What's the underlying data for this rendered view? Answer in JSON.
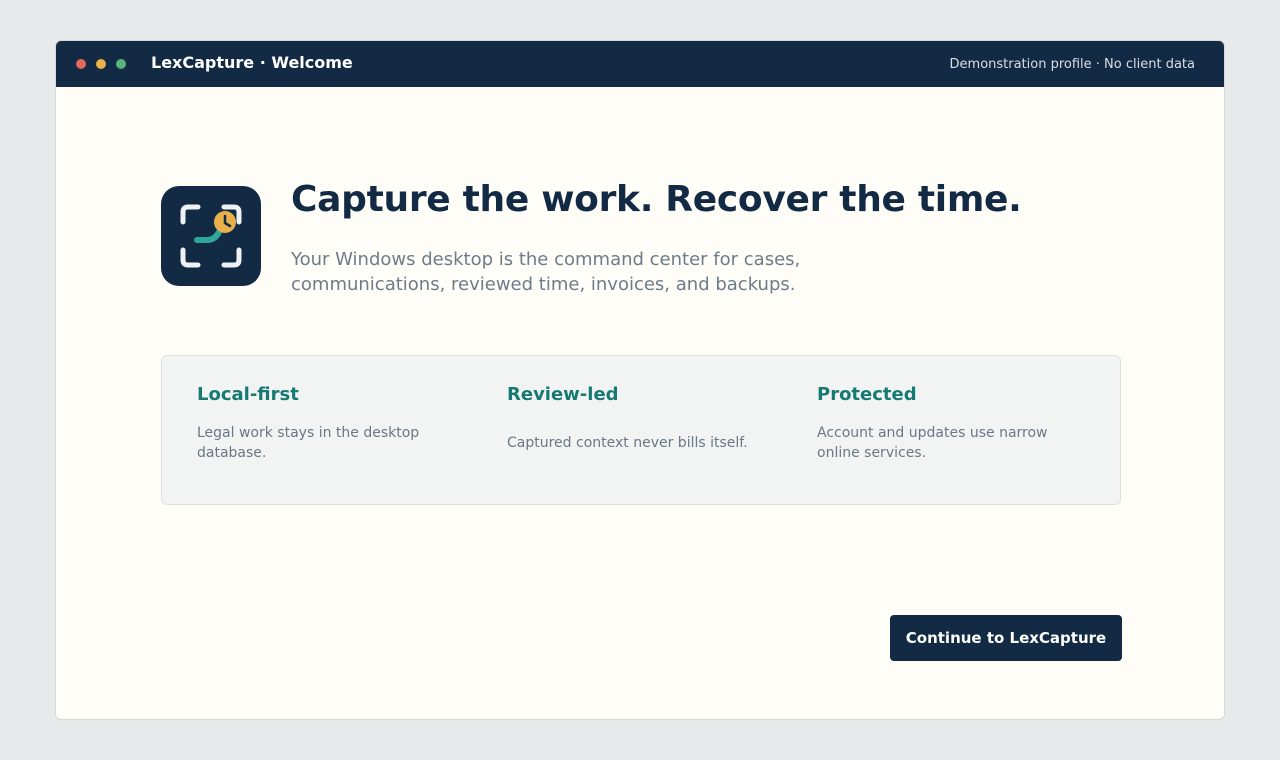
{
  "window": {
    "title": "LexCapture · Welcome",
    "profile_note": "Demonstration profile · No client data",
    "controls": [
      "close",
      "minimize",
      "maximize"
    ]
  },
  "hero": {
    "icon": "capture-clock-icon",
    "headline": "Capture the work. Recover the time.",
    "subhead": "Your Windows desktop is the command center for cases, communications, reviewed time, invoices, and backups."
  },
  "features": [
    {
      "title": "Local-first",
      "description": "Legal work stays in the desktop database."
    },
    {
      "title": "Review-led",
      "description": "Captured context never bills itself."
    },
    {
      "title": "Protected",
      "description": "Account and updates use narrow online services."
    }
  ],
  "actions": {
    "continue_label": "Continue to LexCapture"
  },
  "colors": {
    "brand_navy": "#132a44",
    "accent_teal": "#177a72",
    "accent_amber": "#e8b04a",
    "background": "#fefdf8"
  }
}
